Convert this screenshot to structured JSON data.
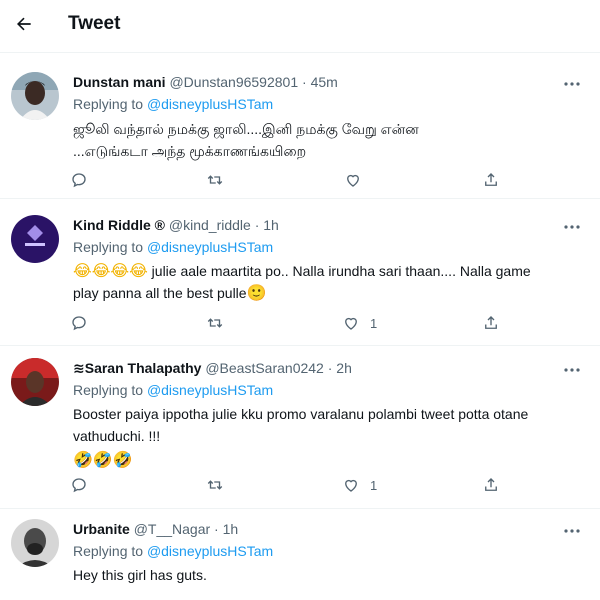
{
  "header": {
    "title": "Tweet"
  },
  "replies": [
    {
      "name": "Dunstan mani",
      "handle": "@Dunstan96592801",
      "sep": "·",
      "time": "45m",
      "replying_prefix": "Replying to",
      "mention": "@disneyplusHSTam",
      "text_lines": [
        "ஜூலி வந்தால் நமக்கு ஜாலி....இனி நமக்கு வேறு என்ன",
        "...எடுங்கடா அந்த மூக்காணங்கயிறை"
      ],
      "like_count": ""
    },
    {
      "name": "Kind Riddle",
      "badge": "®",
      "handle": "@kind_riddle",
      "sep": "·",
      "time": "1h",
      "replying_prefix": "Replying to",
      "mention": "@disneyplusHSTam",
      "emoji_prefix": "😂😂😂😂",
      "text_line1": " julie aale maartita po.. Nalla irundha sari thaan.... Nalla game",
      "text_line2": "play panna all the best pulle",
      "emoji_suffix": "🙂",
      "like_count": "1"
    },
    {
      "name": "Saran Thalapathy",
      "name_prefix_symbol": "≋",
      "handle": "@BeastSaran0242",
      "sep": "·",
      "time": "2h",
      "replying_prefix": "Replying to",
      "mention": "@disneyplusHSTam",
      "text_lines": [
        "Booster paiya ippotha julie kku promo varalanu polambi tweet potta otane",
        "vathuduchi. !!!"
      ],
      "emoji_line": "🤣🤣🤣",
      "like_count": "1"
    },
    {
      "name": "Urbanite",
      "handle": "@T__Nagar",
      "sep": "·",
      "time": "1h",
      "replying_prefix": "Replying to",
      "mention": "@disneyplusHSTam",
      "text_lines": [
        "Hey this girl has guts."
      ]
    }
  ]
}
